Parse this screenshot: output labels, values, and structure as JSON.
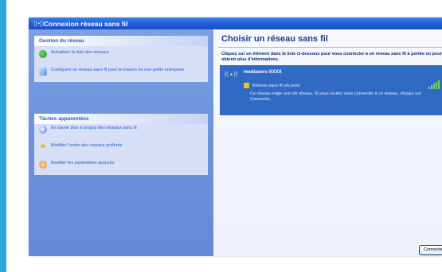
{
  "window": {
    "title": "Connexion réseau sans fil"
  },
  "sidebar": {
    "network_tasks": {
      "header": "Gestion du réseau",
      "items": [
        {
          "label": "Actualiser la liste des réseaux",
          "icon": "refresh-icon"
        },
        {
          "label": "Configurer un réseau sans fil pour la maison ou une petite entreprise",
          "icon": "configure-network-icon"
        }
      ]
    },
    "related_tasks": {
      "header": "Tâches apparentées",
      "items": [
        {
          "label": "En savoir plus à propos des réseaux sans fil",
          "icon": "help-icon"
        },
        {
          "label": "Modifier l'ordre des réseaux préférés",
          "icon": "star-icon"
        },
        {
          "label": "Modifier les paramètres avancés",
          "icon": "advanced-settings-icon"
        }
      ]
    }
  },
  "main": {
    "title": "Choisir un réseau sans fil",
    "instructions": "Cliquez sur un élément dans la liste ci-dessous pour vous connecter à un réseau sans fil à portée ou pour obtenir plus d'informations.",
    "network": {
      "ssid": "mediaserv-XXXX",
      "security": "Réseau sans fil sécurisé",
      "description": "Ce réseau exige une clé réseau. Si vous voulez vous connecter à ce réseau, cliquez sur Connecter.",
      "signal_icon": "signal-strength-icon"
    },
    "connect_label": "Connecter"
  },
  "colors": {
    "accent_bar": "#29a8e0",
    "titlebar": "#1f5ad4",
    "selected_network": "#316ac5"
  }
}
